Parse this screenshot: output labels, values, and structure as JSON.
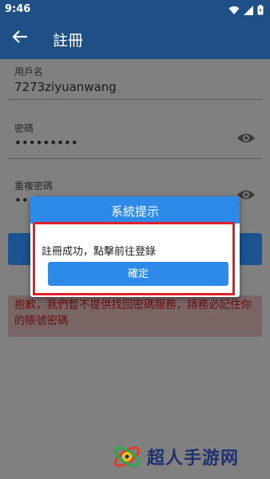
{
  "status_bar": {
    "time": "9:46"
  },
  "app_bar": {
    "title": "註冊"
  },
  "form": {
    "username": {
      "label": "用戶名",
      "value": "7273ziyuanwang"
    },
    "password": {
      "label": "密碼",
      "value": "•••••••••"
    },
    "confirm_password": {
      "label": "重複密碼",
      "value": "••••"
    }
  },
  "notice": {
    "text": "抱歉，我們暫不提供找回密碼服務，請務必記住你的賬號密碼"
  },
  "dialog": {
    "title": "系統提示",
    "message": "註冊成功，點擊前往登錄",
    "confirm_label": "確定"
  },
  "watermark": {
    "text": "超人手游网"
  },
  "colors": {
    "app_bar": "#1e4f85",
    "dialog_accent": "#2d8ae8",
    "highlight": "#e0202a",
    "notice_text": "#6a0f0f"
  }
}
